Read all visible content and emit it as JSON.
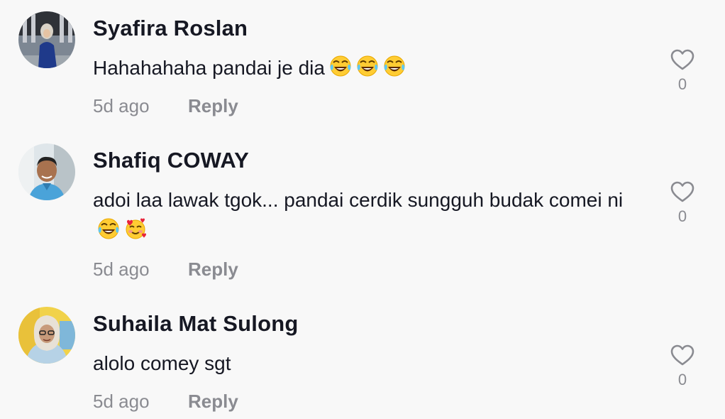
{
  "comments": [
    {
      "username": "Syafira Roslan",
      "text": "Hahahahaha pandai je dia",
      "emojis": [
        "face-with-tears-of-joy",
        "face-with-tears-of-joy",
        "face-with-tears-of-joy"
      ],
      "time": "5d ago",
      "reply_label": "Reply",
      "like_count": "0"
    },
    {
      "username": "Shafiq COWAY",
      "text": "adoi laa lawak tgok... pandai cerdik sungguh budak comei ni",
      "emojis": [
        "face-with-tears-of-joy",
        "smiling-face-with-hearts"
      ],
      "time": "5d ago",
      "reply_label": "Reply",
      "like_count": "0"
    },
    {
      "username": "Suhaila Mat Sulong",
      "text": "alolo comey sgt",
      "emojis": [],
      "time": "5d ago",
      "reply_label": "Reply",
      "like_count": "0"
    }
  ],
  "icons": {
    "like": "heart-outline-icon"
  },
  "colors": {
    "background": "#f8f8f8",
    "username": "#161823",
    "secondary_text": "#8a8b91",
    "heart_outline": "#8a8b91"
  }
}
